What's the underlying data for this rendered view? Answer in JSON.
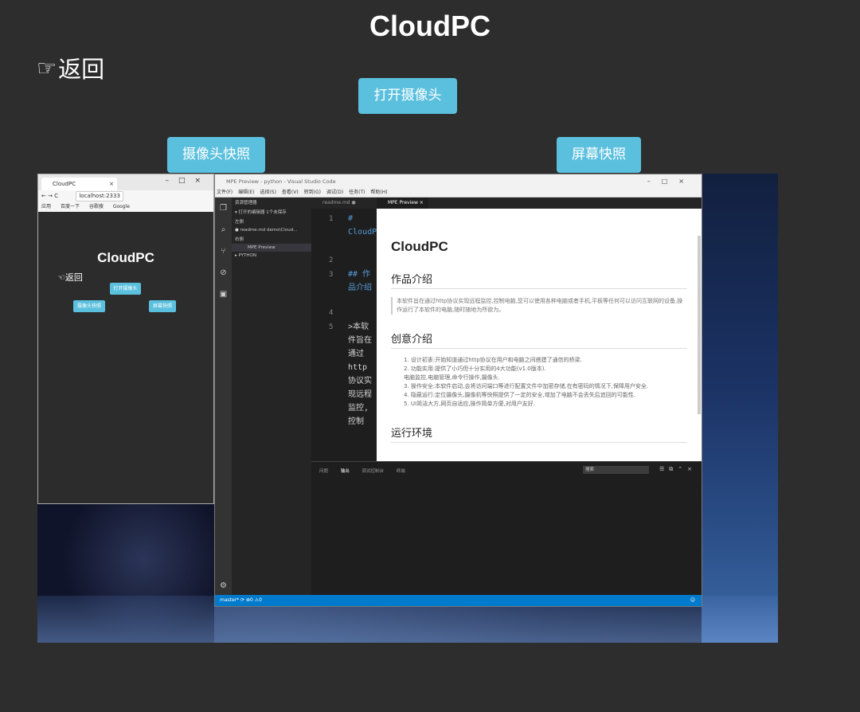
{
  "title": "CloudPC",
  "back_label": "返回",
  "buttons": {
    "open_camera": "打开摄像头",
    "camera_snapshot": "摄像头快照",
    "screen_snapshot": "屏幕快照"
  },
  "screenshot": {
    "browser": {
      "tab_title": "CloudPC",
      "tab_close": "×",
      "window_controls": "–□×",
      "address": "localhost:2333",
      "bookmarks": [
        "应用",
        "百度一下",
        "谷歌搜",
        "Google"
      ],
      "page": {
        "title": "CloudPC",
        "back_label": "返回",
        "open_camera": "打开摄像头",
        "camera_snapshot": "摄像头快照",
        "screen_snapshot": "屏幕快照"
      }
    },
    "vscode": {
      "window_title": "MPE Preview - python - Visual Studio Code",
      "window_controls": "–□×",
      "menu": [
        "文件(F)",
        "编辑(E)",
        "选择(S)",
        "查看(V)",
        "转到(G)",
        "调试(D)",
        "任务(T)",
        "帮助(H)"
      ],
      "sidebar": {
        "header": "资源管理器",
        "open_editors": "▾ 打开的编辑器 1个未保存",
        "group_left": "左侧",
        "file_readme": "● readme.md demo\\Cloud...",
        "group_right": "右侧",
        "file_preview": "MPE Preview",
        "project": "▸ PYTHON"
      },
      "editor_tab": "readme.md ●",
      "editor_lines": [
        {
          "num": "1",
          "text": "# CloudPC"
        },
        {
          "num": "2",
          "text": ""
        },
        {
          "num": "3",
          "text": "## 作品介绍"
        },
        {
          "num": "4",
          "text": ""
        },
        {
          "num": "5",
          "text": ">本软件旨在通过http协议实现远程监控,控制"
        }
      ],
      "preview_tab": "MPE Preview ×",
      "preview": {
        "h1": "CloudPC",
        "h2_intro": "作品介绍",
        "intro_text": "本软件旨在通过http协议实现远程监控,控制电脑,您可以使用各种电脑或者手机,平板等任何可以访问互联网的设备,操作运行了本软件的电脑,随时随地为所欲为。",
        "h2_idea": "创意介绍",
        "idea_items": [
          "1. 设计初衷:开始知道通过http协议在用户和电脑之间搭建了通信的桥梁.",
          "2. 功能实用:提供了小巧但十分实用的4大功能(v1.0版本).",
          "   电脑监控,电脑管理,命令行操作,摄像头.",
          "3. 操作安全:本软件启动,会将访问端口等进行配置文件中加密存储,在有密码的情况下,保障用户安全.",
          "4. 隐蔽运行:定位摄像头,摄像机等快照提供了一定的安全,增加了电脑不会丢失后追回的可能性.",
          "5. UI简洁大方,网页自适应,操作简单方便,对用户友好."
        ],
        "h2_env": "运行环境"
      },
      "panel_tabs": [
        "问题",
        "输出",
        "调试控制台",
        "终端"
      ],
      "panel_active": "输出",
      "panel_dropdown": "搜索",
      "status": "master* ⟳ ⊗0 ⚠0"
    }
  }
}
